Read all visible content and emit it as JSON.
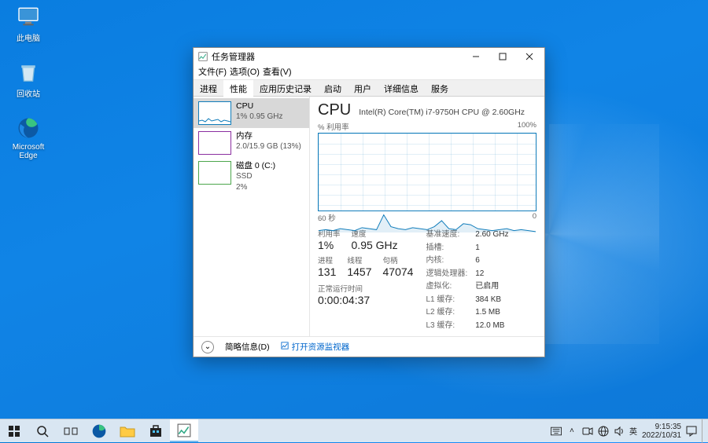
{
  "desktop": {
    "icons": [
      {
        "name": "this-pc",
        "label": "此电脑"
      },
      {
        "name": "recycle-bin",
        "label": "回收站"
      },
      {
        "name": "edge",
        "label": "Microsoft Edge"
      }
    ]
  },
  "window": {
    "title": "任务管理器",
    "menus": [
      "文件(F)",
      "选项(O)",
      "查看(V)"
    ],
    "tabs": [
      "进程",
      "性能",
      "应用历史记录",
      "启动",
      "用户",
      "详细信息",
      "服务"
    ],
    "active_tab": 1
  },
  "sidebar": {
    "items": [
      {
        "name": "CPU",
        "sub": "1% 0.95 GHz",
        "color": "#117dbb",
        "selected": true
      },
      {
        "name": "内存",
        "sub": "2.0/15.9 GB (13%)",
        "color": "#8b2fa0",
        "selected": false
      },
      {
        "name": "磁盘 0 (C:)",
        "sub": "SSD\n2%",
        "color": "#4ca64c",
        "selected": false
      }
    ]
  },
  "detail": {
    "title": "CPU",
    "model": "Intel(R) Core(TM) i7-9750H CPU @ 2.60GHz",
    "graph_top_left": "% 利用率",
    "graph_top_right": "100%",
    "graph_bottom_left": "60 秒",
    "graph_bottom_right": "0",
    "stats_left": [
      {
        "label": "利用率",
        "value": "1%"
      },
      {
        "label": "速度",
        "value": "0.95 GHz"
      }
    ],
    "stats_left2": [
      {
        "label": "进程",
        "value": "131"
      },
      {
        "label": "线程",
        "value": "1457"
      },
      {
        "label": "句柄",
        "value": "47074"
      }
    ],
    "uptime_label": "正常运行时间",
    "uptime_value": "0:00:04:37",
    "stats_right": [
      [
        "基准速度:",
        "2.60 GHz"
      ],
      [
        "插槽:",
        "1"
      ],
      [
        "内核:",
        "6"
      ],
      [
        "逻辑处理器:",
        "12"
      ],
      [
        "虚拟化:",
        "已启用"
      ],
      [
        "L1 缓存:",
        "384 KB"
      ],
      [
        "L2 缓存:",
        "1.5 MB"
      ],
      [
        "L3 缓存:",
        "12.0 MB"
      ]
    ]
  },
  "footer": {
    "fewer": "简略信息(D)",
    "resmon": "打开资源监视器"
  },
  "taskbar": {
    "ime": "英",
    "time": "9:15:35",
    "date": "2022/10/31"
  },
  "chart_data": {
    "type": "line",
    "title": "% 利用率",
    "xlabel": "60 秒 → 0",
    "ylabel": "% 利用率",
    "ylim": [
      0,
      100
    ],
    "x_seconds_ago": [
      60,
      58,
      56,
      54,
      52,
      50,
      48,
      46,
      44,
      42,
      40,
      38,
      36,
      34,
      32,
      30,
      28,
      26,
      24,
      22,
      20,
      18,
      16,
      14,
      12,
      10,
      8,
      6,
      4,
      2,
      0
    ],
    "values_percent": [
      2,
      3,
      2,
      4,
      3,
      2,
      5,
      4,
      3,
      18,
      6,
      4,
      3,
      5,
      4,
      3,
      6,
      12,
      4,
      3,
      9,
      8,
      4,
      3,
      2,
      3,
      4,
      2,
      3,
      2,
      1
    ]
  }
}
